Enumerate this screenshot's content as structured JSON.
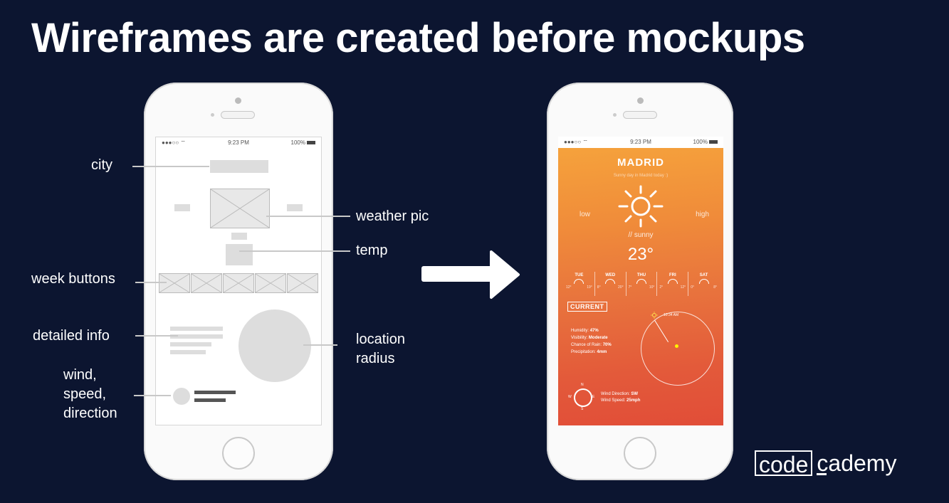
{
  "slide": {
    "title": "Wireframes are created before mockups"
  },
  "wireframe": {
    "status": {
      "signal": "●●●○○ ⌔",
      "time": "9:23 PM",
      "battery": "100%"
    },
    "labels": {
      "city": "city",
      "weather_pic": "weather pic",
      "temp": "temp",
      "week_buttons": "week buttons",
      "detailed_info": "detailed info",
      "location_radius": [
        "location",
        "radius"
      ],
      "wind": [
        "wind,",
        "speed,",
        "direction"
      ]
    }
  },
  "mockup": {
    "status": {
      "signal": "●●●○○ ⌔",
      "time": "9:23 PM",
      "battery": "100%"
    },
    "city": "MADRID",
    "subtitle": "Sunny day in Madrid today :)",
    "low": "low",
    "high": "high",
    "condition": "// sunny",
    "temperature": "23°",
    "days": [
      {
        "name": "TUE",
        "low": "12°",
        "high": "19°"
      },
      {
        "name": "WED",
        "low": "8°",
        "high": "20°"
      },
      {
        "name": "THU",
        "low": "7°",
        "high": "10°"
      },
      {
        "name": "FRI",
        "low": "2°",
        "high": "12°"
      },
      {
        "name": "SAT",
        "low": "0°",
        "high": "8°"
      }
    ],
    "current_label": "CURRENT",
    "stats": [
      {
        "label": "Humidity:",
        "value": "47%"
      },
      {
        "label": "Visibility:",
        "value": "Moderate"
      },
      {
        "label": "Chance of Rain:",
        "value": "70%"
      },
      {
        "label": "Precipitation:",
        "value": "4mm"
      }
    ],
    "clock_time": "10:34 AM",
    "compass": {
      "n": "N",
      "s": "S",
      "w": "W",
      "e": "E"
    },
    "wind": [
      {
        "label": "Wind Direction:",
        "value": "SW"
      },
      {
        "label": "Wind Speed:",
        "value": "25mph"
      }
    ]
  },
  "logo": {
    "boxed": "code",
    "rest": "cademy"
  },
  "colors": {
    "background": "#0c1530",
    "mockup_top": "#f6a53c",
    "mockup_bottom": "#e14d38"
  }
}
